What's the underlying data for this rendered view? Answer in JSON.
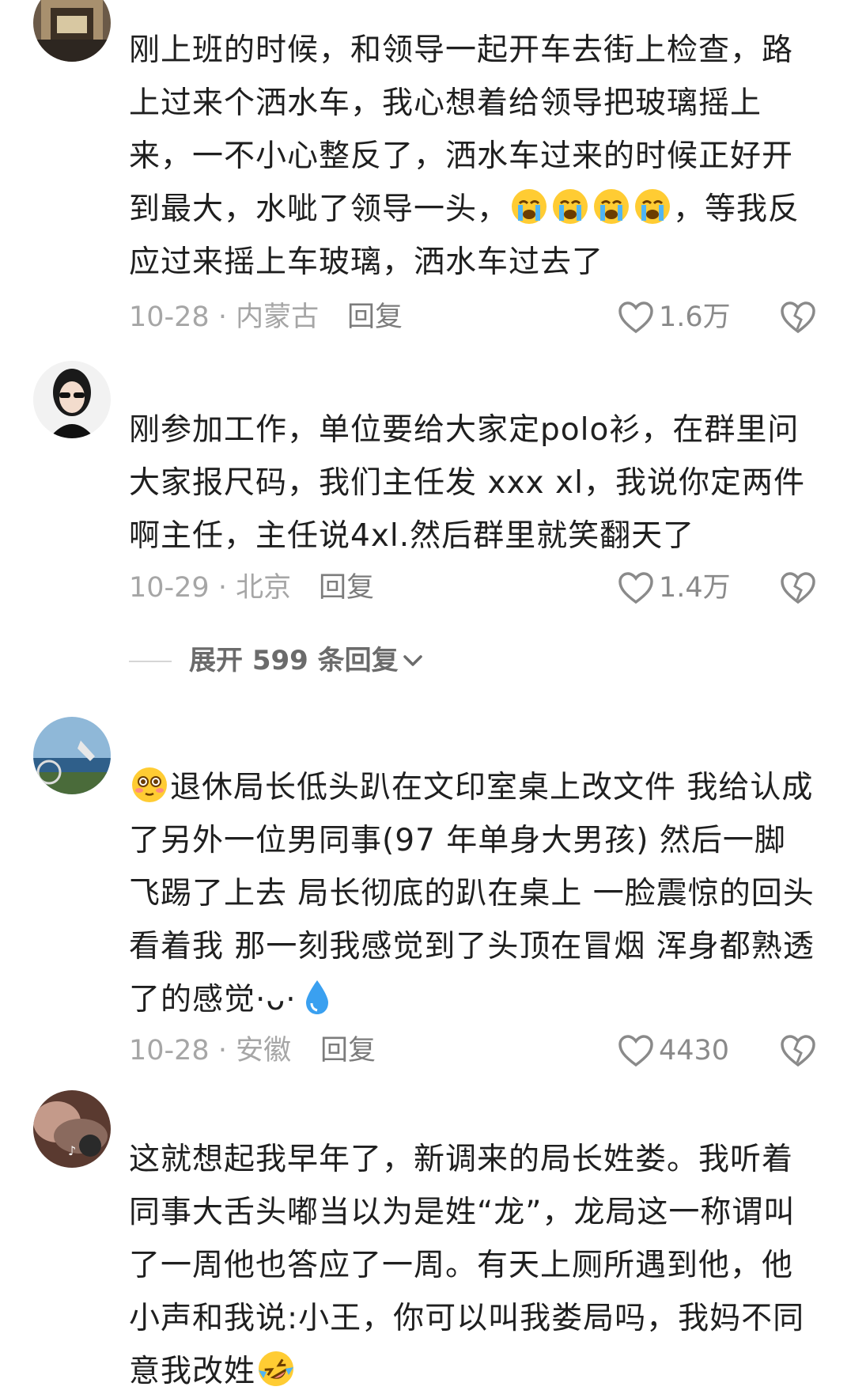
{
  "comments": [
    {
      "text_before": "刚上班的时候，和领导一起开车去街上检查，路上过来个洒水车，我心想着给领导把玻璃摇上来，一不小心整反了，洒水车过来的时候正好开到最大，水呲了领导一头，",
      "emoji": "loudly-crying-face",
      "emoji_count": 4,
      "text_after": "，等我反应过来摇上车玻璃，洒水车过去了",
      "date_location": "10-28 · 内蒙古",
      "reply_label": "回复",
      "likes": "1.6万"
    },
    {
      "text": "刚参加工作，单位要给大家定polo衫，在群里问大家报尺码，我们主任发 xxx  xl，我说你定两件啊主任，主任说4xl.然后群里就笑翻天了",
      "date_location": "10-29 · 北京",
      "reply_label": "回复",
      "likes": "1.4万"
    },
    {
      "emoji_lead": "flushed-face",
      "text": "退休局长低头趴在文印室桌上改文件 我给认成了另外一位男同事(97 年单身大男孩) 然后一脚飞踢了上去 局长彻底的趴在桌上 一脸震惊的回头看着我 那一刻我感觉到了头顶在冒烟 浑身都熟透了的感觉·ᴗ·",
      "emoji_tail": "droplet",
      "date_location": "10-28 · 安徽",
      "reply_label": "回复",
      "likes": "4430"
    },
    {
      "text": "这就想起我早年了，新调来的局长姓娄。我听着同事大舌头嘟当以为是姓“龙”，龙局这一称谓叫了一周他也答应了一周。有天上厕所遇到他，他小声和我说:小王，你可以叫我娄局吗，我妈不同意我改姓",
      "emoji_tail": "rolling-on-floor-laughing"
    }
  ],
  "expand_replies": "展开 599 条回复",
  "icons": {
    "like": "heart-outline-icon",
    "dislike": "broken-heart-icon",
    "chevron": "chevron-down-icon"
  },
  "colors": {
    "meta_gray": "#a6a6a6",
    "text": "#1f1f1f"
  }
}
